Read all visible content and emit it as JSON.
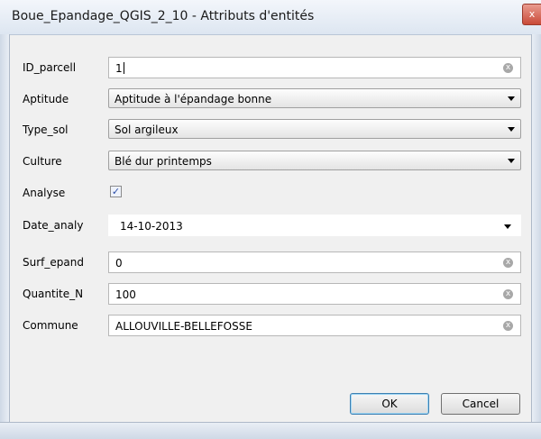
{
  "window": {
    "title": "Boue_Epandage_QGIS_2_10 - Attributs d'entités",
    "close_glyph": "x"
  },
  "fields": {
    "id_parcell": {
      "label": "ID_parcell",
      "value": "1"
    },
    "aptitude": {
      "label": "Aptitude",
      "value": "Aptitude à l'épandage bonne"
    },
    "type_sol": {
      "label": "Type_sol",
      "value": "Sol argileux"
    },
    "culture": {
      "label": "Culture",
      "value": "Blé dur printemps"
    },
    "analyse": {
      "label": "Analyse",
      "checked": true,
      "check_glyph": "✓"
    },
    "date_analy": {
      "label": "Date_analy",
      "value": "14-10-2013"
    },
    "surf_epand": {
      "label": "Surf_epand",
      "value": "0"
    },
    "quantite_n": {
      "label": "Quantite_N",
      "value": "100"
    },
    "commune": {
      "label": "Commune",
      "value": "ALLOUVILLE-BELLEFOSSE"
    }
  },
  "buttons": {
    "ok": "OK",
    "cancel": "Cancel"
  },
  "icons": {
    "clear": "clear-icon",
    "dropdown": "chevron-down-icon",
    "close": "close-icon"
  },
  "colors": {
    "title_bar": "#dde6f1",
    "close_button": "#c94a38",
    "dialog_bg": "#f0f0f0"
  }
}
